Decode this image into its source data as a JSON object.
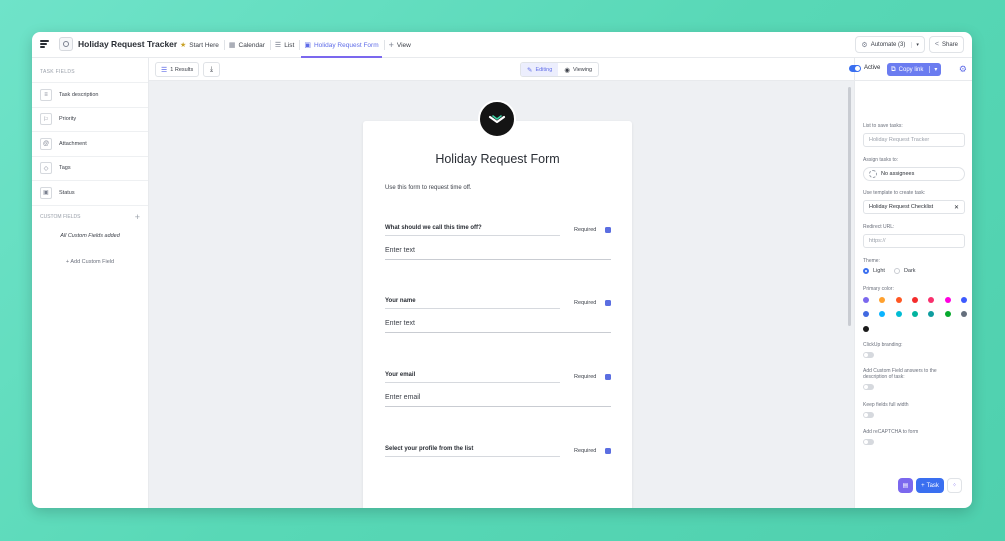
{
  "window": {
    "title": "Holiday Request Tracker"
  },
  "tabs": [
    {
      "label": "Start Here",
      "icon": "star-icon"
    },
    {
      "label": "Calendar",
      "icon": "calendar-icon"
    },
    {
      "label": "List",
      "icon": "list-icon"
    },
    {
      "label": "Holiday Request Form",
      "icon": "form-icon",
      "active": true
    },
    {
      "label": "View",
      "icon": "plus-icon"
    }
  ],
  "top_right": {
    "automate": "Automate (3)",
    "share": "Share"
  },
  "sidebar": {
    "task_fields_heading": "TASK FIELDS",
    "items": [
      {
        "label": "Task description",
        "icon": "text-icon"
      },
      {
        "label": "Priority",
        "icon": "flag-icon"
      },
      {
        "label": "Attachment",
        "icon": "paperclip-icon"
      },
      {
        "label": "Tags",
        "icon": "tag-icon"
      },
      {
        "label": "Status",
        "icon": "status-icon"
      }
    ],
    "custom_fields_heading": "CUSTOM FIELDS",
    "all_added": "All Custom Fields added",
    "add_custom": "+ Add Custom Field"
  },
  "toolbar": {
    "results": "1 Results",
    "editing": "Editing",
    "viewing": "Viewing"
  },
  "form": {
    "title": "Holiday Request Form",
    "description": "Use this form to request time off.",
    "fields": [
      {
        "label": "What should we call this time off?",
        "required": "Required",
        "placeholder": "Enter text"
      },
      {
        "label": "Your name",
        "required": "Required",
        "placeholder": "Enter text"
      },
      {
        "label": "Your email",
        "required": "Required",
        "placeholder": "Enter email"
      },
      {
        "label": "Select your profile from the list",
        "required": "Required",
        "placeholder": ""
      }
    ]
  },
  "right_panel": {
    "active": "Active",
    "copy_link": "Copy link",
    "list_to_save": "List to save tasks:",
    "list_value": "Holiday Request Tracker",
    "assign_tasks": "Assign tasks to:",
    "assignees": "No assignees",
    "use_template": "Use template to create task:",
    "template_value": "Holiday Request Checklist",
    "redirect_url": "Redirect URL:",
    "redirect_placeholder": "https://",
    "theme": "Theme:",
    "theme_light": "Light",
    "theme_dark": "Dark",
    "primary_color": "Primary color:",
    "colors": [
      "#7b68ee",
      "#ffa12f",
      "#ff5722",
      "#f42c2c",
      "#f8306d",
      "#ff00df",
      "#3d5afe",
      "#4169e1",
      "#0ab4ff",
      "#02bcd4",
      "#01b39e",
      "#0f9d9f",
      "#07a92d",
      "#656f7d",
      "#1a1a1a"
    ],
    "clickup_branding": "ClickUp branding:",
    "add_custom_answers": "Add Custom Field answers to the description of task:",
    "keep_full_width": "Keep fields full width",
    "recaptcha": "Add reCAPTCHA to form",
    "task_button": "Task"
  }
}
